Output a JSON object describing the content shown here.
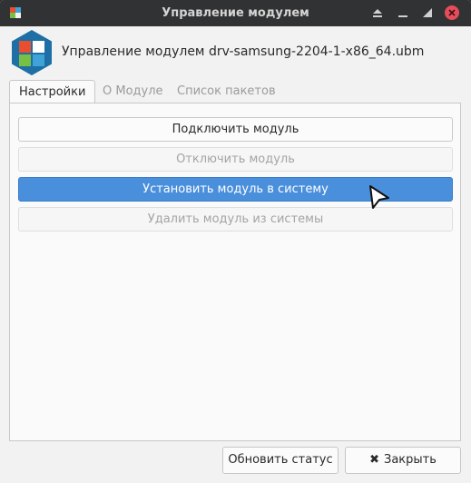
{
  "window": {
    "title": "Управление модулем"
  },
  "header": {
    "module_title": "Управление модулем drv-samsung-2204-1-x86_64.ubm"
  },
  "tabs": [
    {
      "label": "Настройки",
      "active": true
    },
    {
      "label": "О Модуле",
      "active": false
    },
    {
      "label": "Список пакетов",
      "active": false
    }
  ],
  "actions": {
    "connect": "Подключить модуль",
    "disconnect": "Отключить модуль",
    "install": "Установить модуль в систему",
    "remove": "Удалить модуль из системы"
  },
  "footer": {
    "refresh_label": "Обновить статус",
    "close_label": "Закрыть"
  },
  "colors": {
    "titlebar": "#313233",
    "accent": "#4a8fdc",
    "close_button": "#e54d5a",
    "logo_hex": "#1d6fa5",
    "logo_red": "#e94e2f",
    "logo_green": "#78c043",
    "logo_blue": "#3fa3d8"
  },
  "icons": {
    "app": "module-app-icon",
    "logo": "module-logo-icon",
    "maximize": "eject-maximize-icon",
    "minimize": "minimize-icon",
    "restore": "restore-icon",
    "close": "close-icon",
    "cursor": "mouse-pointer-icon"
  }
}
